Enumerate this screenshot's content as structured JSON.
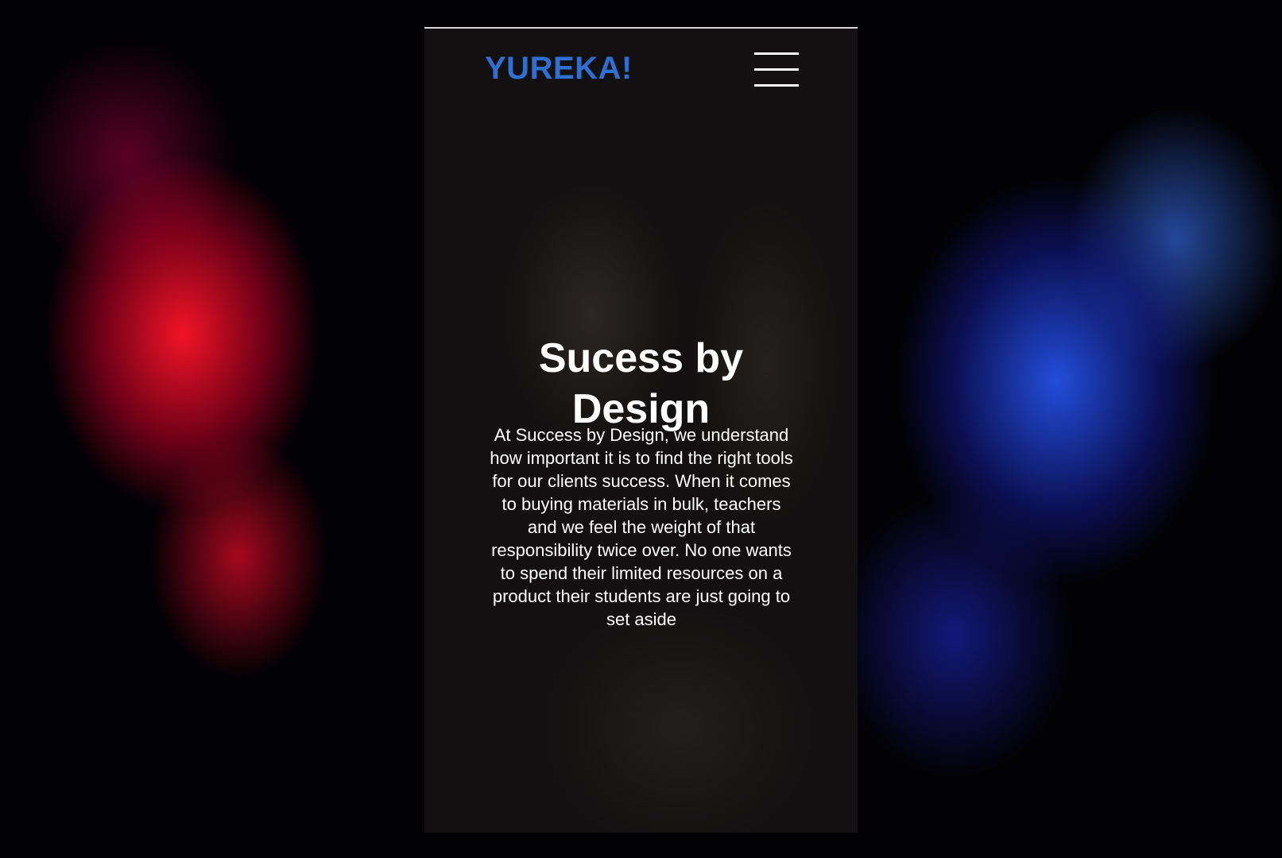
{
  "header": {
    "logo": "YUREKA!",
    "menu_icon": "hamburger-menu-icon"
  },
  "hero": {
    "title": "Sucess by Design",
    "body": "At Success by Design, we understand how important it is to find the right tools for our clients success. When it comes to buying materials in bulk, teachers and we feel the weight of that responsibility twice over. No one wants to spend their limited resources on a product their students are just going to set aside"
  },
  "colors": {
    "logo": "#2e6fd0",
    "text": "#ffffff",
    "page_background": "#121010"
  }
}
